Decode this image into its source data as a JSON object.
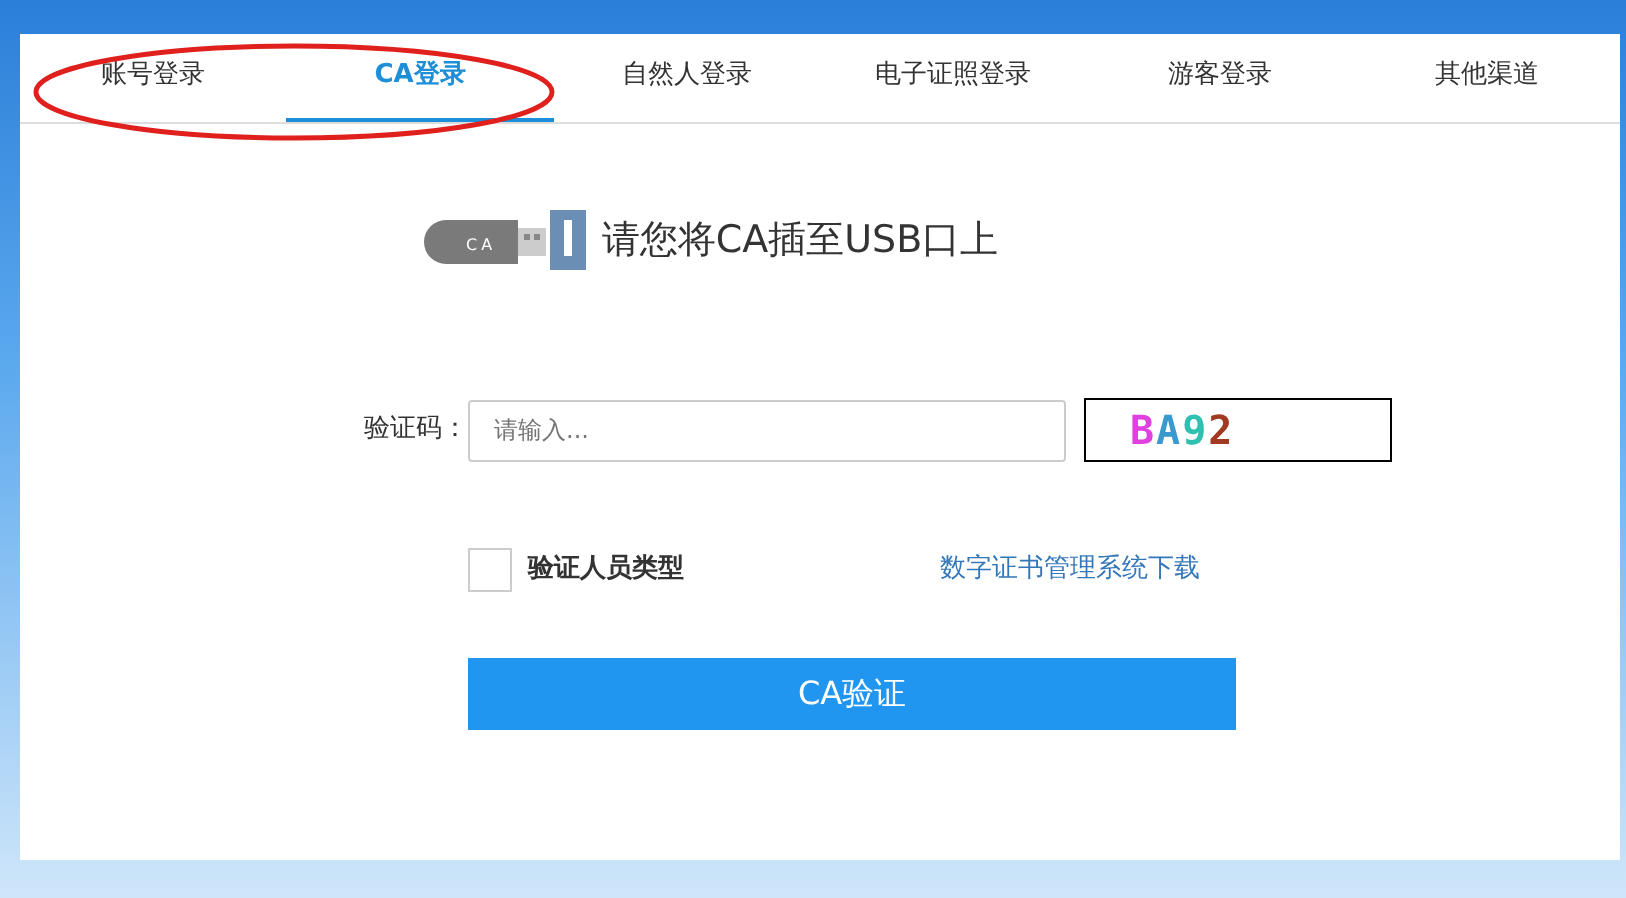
{
  "tabs": [
    {
      "label": "账号登录",
      "selected": false
    },
    {
      "label": "CA登录",
      "selected": true
    },
    {
      "label": "自然人登录",
      "selected": false
    },
    {
      "label": "电子证照登录",
      "selected": false
    },
    {
      "label": "游客登录",
      "selected": false
    },
    {
      "label": "其他渠道",
      "selected": false
    }
  ],
  "usb_hint": {
    "icon_text": "CA",
    "text": "请您将CA插至USB口上"
  },
  "captcha": {
    "label": "验证码：",
    "placeholder": "请输入...",
    "image_text": "BA92"
  },
  "verify_type": {
    "label": "验证人员类型",
    "checked": false
  },
  "download_link": "数字证书管理系统下载",
  "submit_button": "CA验证"
}
